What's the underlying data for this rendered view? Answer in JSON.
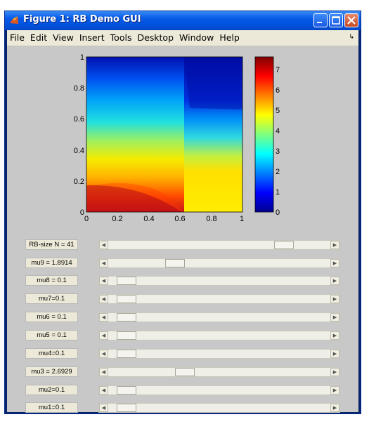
{
  "window": {
    "title": "Figure 1: RB Demo GUI"
  },
  "menu": [
    "File",
    "Edit",
    "View",
    "Insert",
    "Tools",
    "Desktop",
    "Window",
    "Help"
  ],
  "plot": {
    "x_ticks": [
      "0",
      "0.2",
      "0.4",
      "0.6",
      "0.8",
      "1"
    ],
    "y_ticks": [
      "0",
      "0.2",
      "0.4",
      "0.6",
      "0.8",
      "1"
    ],
    "colorbar_ticks": [
      "0",
      "1",
      "2",
      "3",
      "4",
      "5",
      "6",
      "7"
    ]
  },
  "sliders": [
    {
      "label": "RB-size N = 41",
      "position": 0.82
    },
    {
      "label": "mu9 = 1.8914",
      "position": 0.28
    },
    {
      "label": "mu8 = 0.1",
      "position": 0.04
    },
    {
      "label": "mu7=0.1",
      "position": 0.04
    },
    {
      "label": "mu6 = 0.1",
      "position": 0.04
    },
    {
      "label": "mu5 = 0.1",
      "position": 0.04
    },
    {
      "label": "mu4=0.1",
      "position": 0.04
    },
    {
      "label": "mu3 = 2.6929",
      "position": 0.33
    },
    {
      "label": "mu2=0.1",
      "position": 0.04
    },
    {
      "label": "mu1=0.1",
      "position": 0.04
    }
  ]
}
